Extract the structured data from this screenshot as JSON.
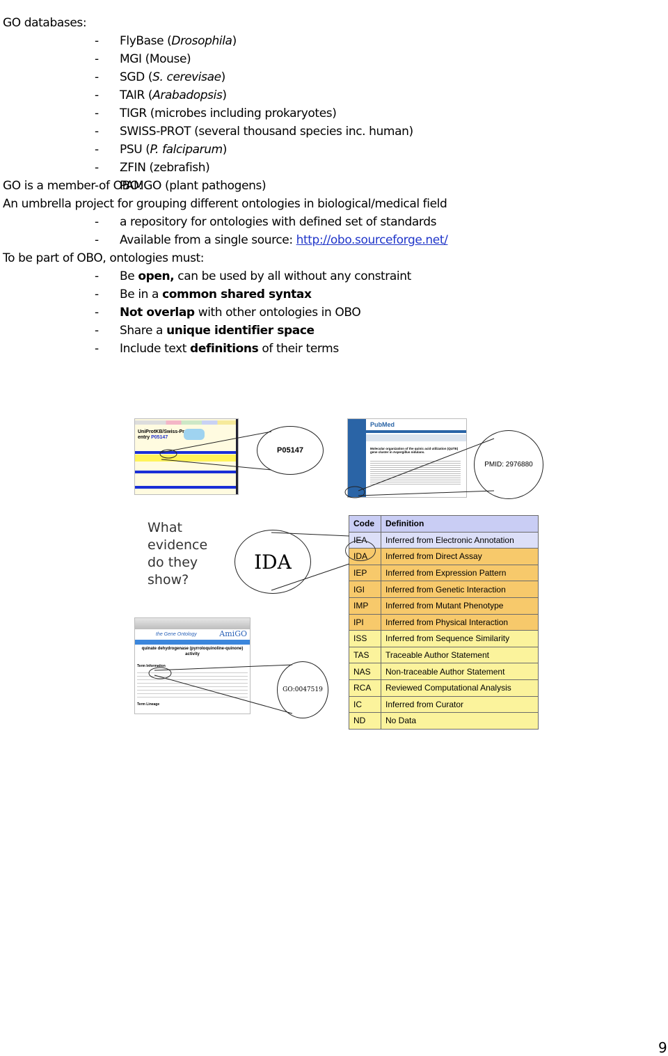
{
  "text": {
    "heading_databases": "GO databases:",
    "databases": [
      {
        "name": "FlyBase (",
        "italic": "Drosophila",
        "suffix": ")"
      },
      {
        "name": "MGI (Mouse)",
        "italic": "",
        "suffix": ""
      },
      {
        "name": "SGD (",
        "italic": "S. cerevisae",
        "suffix": ")"
      },
      {
        "name": "TAIR (",
        "italic": "Arabadopsis",
        "suffix": ")"
      },
      {
        "name": "TIGR (microbes including prokaryotes)",
        "italic": "",
        "suffix": ""
      },
      {
        "name": "SWISS-PROT (several thousand species inc. human)",
        "italic": "",
        "suffix": ""
      },
      {
        "name": "PSU (",
        "italic": "P. falciparum",
        "suffix": ")"
      },
      {
        "name": "ZFIN (zebrafish)",
        "italic": "",
        "suffix": ""
      },
      {
        "name": "PAMGO (plant pathogens)",
        "italic": "",
        "suffix": ""
      }
    ],
    "obo_member": "GO is a member of OBO:",
    "obo_desc": "An umbrella project for grouping different ontologies in biological/medical field",
    "obo_points": [
      {
        "pre": "a repository for ontologies with defined set of standards",
        "link": ""
      },
      {
        "pre": "Available from a single source: ",
        "link": "http://obo.sourceforge.net/"
      }
    ],
    "obo_must": "To be part of OBO, ontologies must:",
    "requirements": [
      {
        "pre": "Be ",
        "bold": "open,",
        "post": " can be used by all without any constraint"
      },
      {
        "pre": "Be in a ",
        "bold": "common shared syntax",
        "post": ""
      },
      {
        "pre": "",
        "bold": "Not overlap",
        "post": " with other ontologies in OBO"
      },
      {
        "pre": "Share a ",
        "bold": "unique identifier space",
        "post": ""
      },
      {
        "pre": "Include text ",
        "bold": "definitions",
        "post": " of their terms"
      }
    ],
    "dash": "-",
    "page_number": "9"
  },
  "figure": {
    "uniprot": {
      "title": "UniProtKB/Swiss-Prot",
      "entry_label": "entry",
      "entry_id": "P05147",
      "callout": "P05147"
    },
    "pubmed": {
      "brand": "PubMed",
      "article_title": "Molecular organization of the quinic acid utilization (QUTE) gene cluster in Aspergillus nidulans.",
      "callout": "PMID: 2976880"
    },
    "question": [
      "What",
      "evidence",
      "do they",
      "show?"
    ],
    "ida_callout": "IDA",
    "amigo": {
      "brand": "AmiGO",
      "subtitle": "the Gene Ontology",
      "term": "quinate dehydrogenase (pyrroloquinoline-quinone) activity",
      "section1": "Term Information",
      "section2": "Term Lineage",
      "callout": "GO:0047519"
    },
    "evidence_table": {
      "headers": [
        "Code",
        "Definition"
      ],
      "rows": [
        {
          "code": "IEA",
          "definition": "Inferred from Electronic Annotation"
        },
        {
          "code": "IDA",
          "definition": "Inferred from Direct Assay"
        },
        {
          "code": "IEP",
          "definition": "Inferred from Expression Pattern"
        },
        {
          "code": "IGI",
          "definition": "Inferred from Genetic Interaction"
        },
        {
          "code": "IMP",
          "definition": "Inferred from Mutant Phenotype"
        },
        {
          "code": "IPI",
          "definition": "Inferred from Physical Interaction"
        },
        {
          "code": "ISS",
          "definition": "Inferred from Sequence Similarity"
        },
        {
          "code": "TAS",
          "definition": "Traceable Author Statement"
        },
        {
          "code": "NAS",
          "definition": "Non-traceable Author Statement"
        },
        {
          "code": "RCA",
          "definition": "Reviewed Computational Analysis"
        },
        {
          "code": "IC",
          "definition": "Inferred from Curator"
        },
        {
          "code": "ND",
          "definition": "No Data"
        }
      ]
    }
  }
}
